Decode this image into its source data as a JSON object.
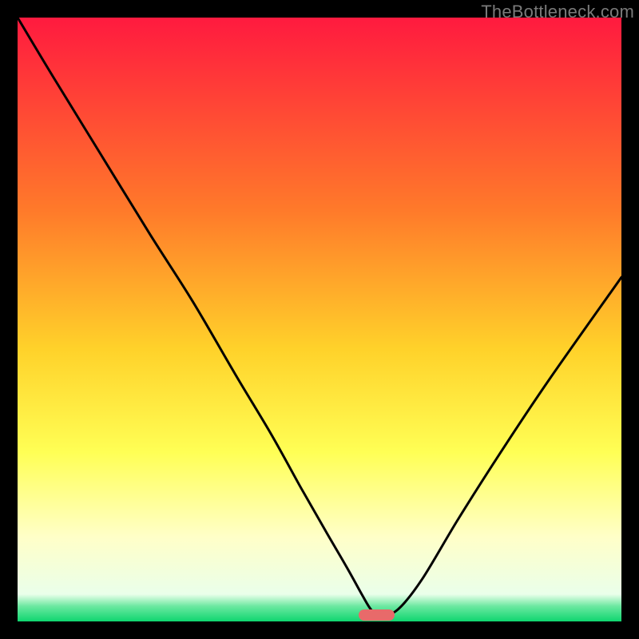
{
  "watermark": "TheBottleneck.com",
  "colors": {
    "top": "#ff1a3f",
    "orange": "#ff8a1f",
    "yellow": "#ffe52a",
    "pale": "#ffffc0",
    "green": "#18e07a",
    "green2": "#0fd66f",
    "marker": "#e86a6a",
    "curve": "#000000",
    "bg": "#000000"
  },
  "chart_data": {
    "type": "line",
    "title": "",
    "xlabel": "",
    "ylabel": "",
    "xlim": [
      0,
      100
    ],
    "ylim": [
      0,
      100
    ],
    "series": [
      {
        "name": "bottleneck-curve",
        "x": [
          0,
          6,
          14,
          22,
          29,
          36,
          42,
          47,
          51,
          54.5,
          57,
          58.5,
          60,
          63,
          67,
          73,
          80,
          88,
          100
        ],
        "y": [
          100,
          90,
          77,
          64,
          53,
          41,
          31,
          22,
          15,
          9,
          4.5,
          2,
          0.8,
          2,
          7,
          17,
          28,
          40,
          57
        ]
      }
    ],
    "optimal_marker": {
      "x_start": 56.5,
      "x_end": 62.5,
      "y": 0.9
    },
    "gradient_stops": [
      {
        "offset": 0.0,
        "color": "#ff1a3f"
      },
      {
        "offset": 0.32,
        "color": "#ff7a2a"
      },
      {
        "offset": 0.55,
        "color": "#ffd22a"
      },
      {
        "offset": 0.72,
        "color": "#ffff55"
      },
      {
        "offset": 0.86,
        "color": "#ffffc8"
      },
      {
        "offset": 0.955,
        "color": "#eaffea"
      },
      {
        "offset": 0.975,
        "color": "#6be8a0"
      },
      {
        "offset": 1.0,
        "color": "#0fd66f"
      }
    ]
  }
}
